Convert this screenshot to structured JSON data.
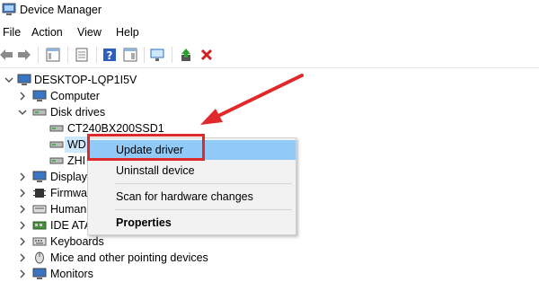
{
  "window": {
    "title": "Device Manager"
  },
  "menu": [
    "File",
    "Action",
    "View",
    "Help"
  ],
  "tree": {
    "root": "DESKTOP-LQP1I5V",
    "computer": "Computer",
    "disk_drives": "Disk drives",
    "disks": [
      "CT240BX200SSD1",
      "WD",
      "ZHI"
    ],
    "display": "Display",
    "firmware": "Firmwa",
    "human": "Human",
    "ide": "IDE ATA",
    "keyboards": "Keyboards",
    "mice": "Mice and other pointing devices",
    "monitors": "Monitors"
  },
  "context_menu": {
    "update": "Update driver",
    "uninstall": "Uninstall device",
    "scan": "Scan for hardware changes",
    "properties": "Properties"
  },
  "colors": {
    "highlight": "#91c9f7",
    "annotation": "#e0292b",
    "selection": "#cce8ff"
  }
}
